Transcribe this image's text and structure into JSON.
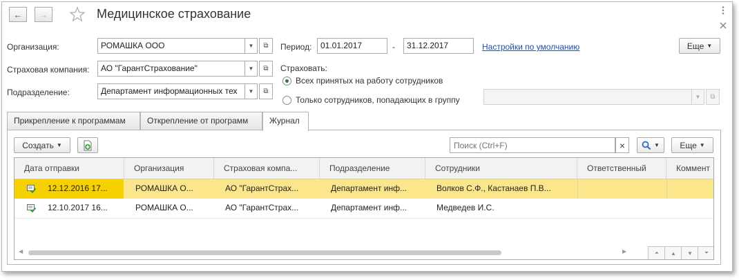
{
  "window": {
    "title": "Медицинское страхование"
  },
  "nav": {
    "back": "←",
    "forward": "→"
  },
  "header": {
    "more_label": "Еще"
  },
  "form": {
    "organization": {
      "label": "Организация:",
      "value": "РОМАШКА ООО"
    },
    "insurer": {
      "label": "Страховая компания:",
      "value": "АО \"ГарантСтрахование\""
    },
    "department": {
      "label": "Подразделение:",
      "value": "Департамент информационных тех"
    },
    "period": {
      "label": "Период:",
      "from": "01.01.2017",
      "dash": "-",
      "to": "31.12.2017"
    },
    "defaults_link": "Настройки по умолчанию",
    "insure": {
      "label": "Страховать:",
      "options": [
        {
          "label": "Всех принятых на работу сотрудников",
          "selected": true
        },
        {
          "label": "Только сотрудников, попадающих в группу",
          "selected": false
        }
      ]
    }
  },
  "tabs": [
    {
      "label": "Прикрепление к программам",
      "active": false
    },
    {
      "label": "Открепление от программ",
      "active": false
    },
    {
      "label": "Журнал",
      "active": true
    }
  ],
  "toolbar": {
    "create_label": "Создать",
    "search_placeholder": "Поиск (Ctrl+F)",
    "clear": "×",
    "more_label": "Еще"
  },
  "table": {
    "columns": [
      "Дата отправки",
      "Организация",
      "Страховая компа...",
      "Подразделение",
      "Сотрудники",
      "Ответственный",
      "Коммент"
    ],
    "rows": [
      {
        "date": "12.12.2016 17...",
        "org": "РОМАШКА О...",
        "insurer": "АО \"ГарантСтрах...",
        "dept": "Департамент инф...",
        "employees": "Волков С.Ф., Кастанаев П.В...",
        "responsible": "",
        "comment": "",
        "selected": true
      },
      {
        "date": "12.10.2017 16...",
        "org": "РОМАШКА О...",
        "insurer": "АО \"ГарантСтрах...",
        "dept": "Департамент инф...",
        "employees": "Медведев И.С.",
        "responsible": "",
        "comment": "",
        "selected": false
      }
    ]
  },
  "colors": {
    "selected_row": "#fbe68b",
    "selected_row_date": "#f7d000",
    "link": "#1c4fa3"
  }
}
